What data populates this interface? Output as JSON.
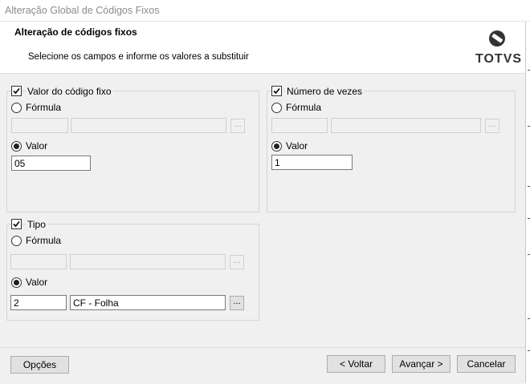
{
  "window": {
    "title": "Alteração Global de Códigos Fixos"
  },
  "header": {
    "title": "Alteração de códigos fixos",
    "subtitle": "Selecione os campos e informe os valores a substituir",
    "logo_text": "TOTVS"
  },
  "groups": {
    "valor_codigo": {
      "label": "Valor do código fixo",
      "checked": true,
      "formula_label": "Fórmula",
      "valor_label": "Valor",
      "value": "05",
      "ellipsis": "..."
    },
    "numero_vezes": {
      "label": "Número de vezes",
      "checked": true,
      "formula_label": "Fórmula",
      "valor_label": "Valor",
      "value": "1",
      "ellipsis": "..."
    },
    "tipo": {
      "label": "Tipo",
      "checked": true,
      "formula_label": "Fórmula",
      "valor_label": "Valor",
      "value": "2",
      "description": "CF - Folha",
      "ellipsis": "..."
    }
  },
  "footer": {
    "options_label": "Opções",
    "back_label": "< Voltar",
    "next_label": "Avançar >",
    "cancel_label": "Cancelar"
  }
}
